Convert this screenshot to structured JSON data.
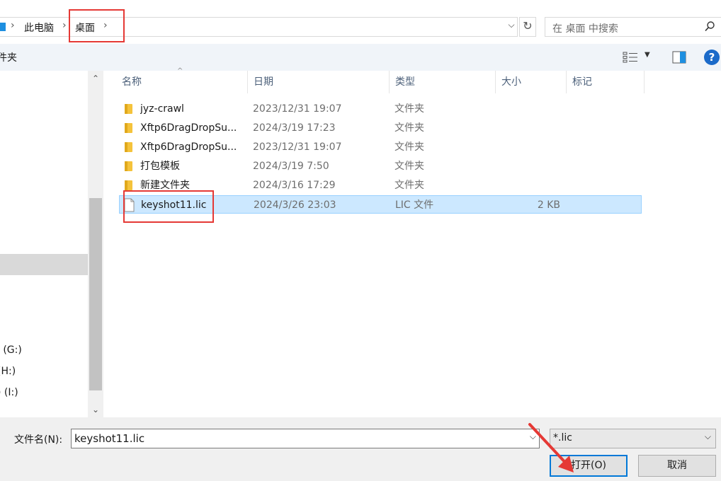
{
  "address_bar": {
    "breadcrumbs": [
      "此电脑",
      "桌面"
    ],
    "search_placeholder": "在 桌面 中搜索"
  },
  "toolbar": {
    "new_folder_label": "件夹"
  },
  "nav": {
    "items": [
      {
        "label": "l (G:)"
      },
      {
        "label": "(H:)"
      },
      {
        "label": ") (I:)"
      }
    ]
  },
  "columns": [
    "名称",
    "日期",
    "类型",
    "大小",
    "标记"
  ],
  "files": [
    {
      "name": "jyz-crawl",
      "date": "2023/12/31 19:07",
      "type": "文件夹",
      "size": "",
      "kind": "folder"
    },
    {
      "name": "Xftp6DragDropSu...",
      "date": "2024/3/19 17:23",
      "type": "文件夹",
      "size": "",
      "kind": "folder"
    },
    {
      "name": "Xftp6DragDropSu...",
      "date": "2023/12/31 19:07",
      "type": "文件夹",
      "size": "",
      "kind": "folder"
    },
    {
      "name": "打包模板",
      "date": "2024/3/19 7:50",
      "type": "文件夹",
      "size": "",
      "kind": "folder"
    },
    {
      "name": "新建文件夹",
      "date": "2024/3/16 17:29",
      "type": "文件夹",
      "size": "",
      "kind": "folder"
    },
    {
      "name": "keyshot11.lic",
      "date": "2024/3/26 23:03",
      "type": "LIC 文件",
      "size": "2 KB",
      "kind": "file",
      "selected": true
    }
  ],
  "bottom": {
    "filename_label": "文件名(N):",
    "filename_value": "keyshot11.lic",
    "filter_value": "*.lic",
    "open_label": "打开(O)",
    "cancel_label": "取消"
  },
  "colors": {
    "selection": "#cce8ff",
    "annotation": "#e53935",
    "accent": "#0078d7"
  }
}
